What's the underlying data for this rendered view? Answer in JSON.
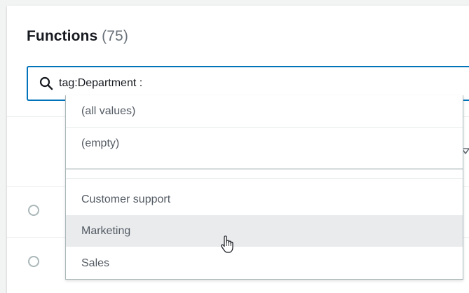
{
  "header": {
    "title": "Functions",
    "count": "(75)"
  },
  "search": {
    "value": "tag:Department :",
    "icon": "search-icon"
  },
  "dropdown": {
    "special_options": [
      {
        "label": "(all values)"
      },
      {
        "label": "(empty)"
      }
    ],
    "value_options": [
      {
        "label": "Customer support"
      },
      {
        "label": "Marketing",
        "highlighted": true
      },
      {
        "label": "Sales"
      }
    ]
  },
  "colors": {
    "focus_border": "#0073bb",
    "highlight_bg": "#e9ebed",
    "text_primary": "#16191f",
    "text_secondary": "#545b64"
  },
  "pointer": "hand-pointer-icon"
}
